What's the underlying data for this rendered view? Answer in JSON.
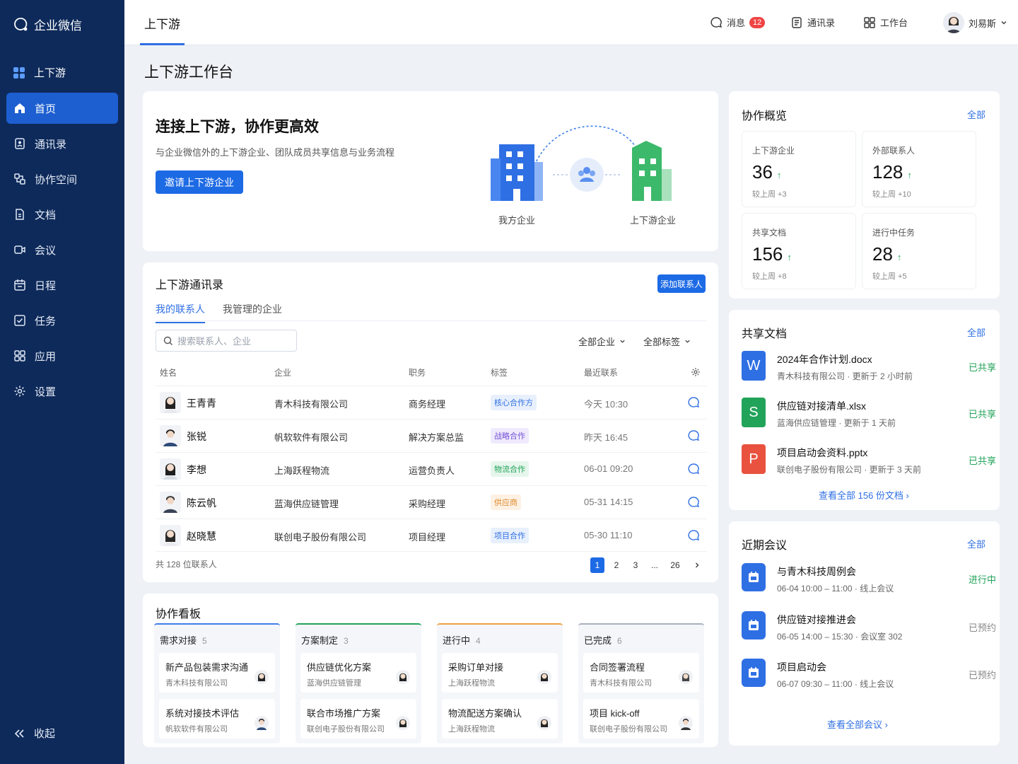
{
  "app": {
    "name": "企业微信"
  },
  "sidebar": {
    "group": "上下游",
    "items": [
      {
        "label": "首页"
      },
      {
        "label": "通讯录"
      },
      {
        "label": "协作空间"
      },
      {
        "label": "文档"
      },
      {
        "label": "会议"
      },
      {
        "label": "日程"
      },
      {
        "label": "任务"
      },
      {
        "label": "应用"
      },
      {
        "label": "设置"
      }
    ],
    "collapse": "收起"
  },
  "topbar": {
    "tab": "上下游",
    "messages": "消息",
    "message_count": "12",
    "contacts": "通讯录",
    "workbench": "工作台",
    "user": "刘易斯"
  },
  "page": {
    "title": "上下游工作台"
  },
  "hero": {
    "title": "连接上下游，协作更高效",
    "desc": "与企业微信外的上下游企业、团队成员共享信息与业务流程",
    "invite": "邀请上下游企业",
    "my_company": "我方企业",
    "partner_company": "上下游企业"
  },
  "contacts": {
    "title": "上下游通讯录",
    "add": "添加联系人",
    "tabs": [
      "我的联系人",
      "我管理的企业"
    ],
    "search_placeholder": "搜索联系人、企业",
    "filters": [
      "全部企业",
      "全部标签"
    ],
    "headers": [
      "姓名",
      "企业",
      "职务",
      "标签",
      "最近联系"
    ],
    "rows": [
      {
        "name": "王青青",
        "company": "青木科技有限公司",
        "title": "商务经理",
        "tag": "核心合作方",
        "time": "今天 10:30"
      },
      {
        "name": "张锐",
        "company": "帆软软件有限公司",
        "title": "解决方案总监",
        "tag": "战略合作",
        "time": "昨天 16:45"
      },
      {
        "name": "李想",
        "company": "上海跃程物流",
        "title": "运营负责人",
        "tag": "物流合作",
        "time": "06-01 09:20"
      },
      {
        "name": "陈云帆",
        "company": "蓝海供应链管理",
        "title": "采购经理",
        "tag": "供应商",
        "time": "05-31 14:15"
      },
      {
        "name": "赵晓慧",
        "company": "联创电子股份有限公司",
        "title": "项目经理",
        "tag": "项目合作",
        "time": "05-30 11:10"
      }
    ],
    "total": "共 128 位联系人",
    "pages": [
      "1",
      "2",
      "3",
      "...",
      "26"
    ]
  },
  "kanban": {
    "title": "协作看板",
    "columns": [
      {
        "name": "需求对接",
        "count": "5",
        "cards": [
          {
            "title": "新产品包装需求沟通",
            "company": "青木科技有限公司"
          },
          {
            "title": "系统对接技术评估",
            "company": "帆软软件有限公司"
          }
        ]
      },
      {
        "name": "方案制定",
        "count": "3",
        "cards": [
          {
            "title": "供应链优化方案",
            "company": "蓝海供应链管理"
          },
          {
            "title": "联合市场推广方案",
            "company": "联创电子股份有限公司"
          }
        ]
      },
      {
        "name": "进行中",
        "count": "4",
        "cards": [
          {
            "title": "采购订单对接",
            "company": "上海跃程物流"
          },
          {
            "title": "物流配送方案确认",
            "company": "上海跃程物流"
          }
        ]
      },
      {
        "name": "已完成",
        "count": "6",
        "cards": [
          {
            "title": "合同签署流程",
            "company": "青木科技有限公司"
          },
          {
            "title": "项目 kick-off",
            "company": "联创电子股份有限公司"
          }
        ]
      }
    ]
  },
  "overview": {
    "title": "协作概览",
    "all": "全部",
    "stats": [
      {
        "label": "上下游企业",
        "value": "36",
        "trend": "↑",
        "delta": "较上周 +3"
      },
      {
        "label": "外部联系人",
        "value": "128",
        "trend": "↑",
        "delta": "较上周 +10"
      },
      {
        "label": "共享文档",
        "value": "156",
        "trend": "↑",
        "delta": "较上周 +8"
      },
      {
        "label": "进行中任务",
        "value": "28",
        "trend": "↑",
        "delta": "较上周 +5"
      }
    ]
  },
  "docs": {
    "title": "共享文档",
    "all": "全部",
    "items": [
      {
        "icon": "W",
        "name": "2024年合作计划.docx",
        "meta": "青木科技有限公司 · 更新于 2 小时前",
        "status": "已共享"
      },
      {
        "icon": "S",
        "name": "供应链对接清单.xlsx",
        "meta": "蓝海供应链管理 · 更新于 1 天前",
        "status": "已共享"
      },
      {
        "icon": "P",
        "name": "项目启动会资料.pptx",
        "meta": "联创电子股份有限公司 · 更新于 3 天前",
        "status": "已共享"
      }
    ],
    "more": "查看全部 156 份文档 ›"
  },
  "meetings": {
    "title": "近期会议",
    "all": "全部",
    "items": [
      {
        "name": "与青木科技周例会",
        "meta": "06-04 10:00 – 11:00 · 线上会议",
        "status": "进行中"
      },
      {
        "name": "供应链对接推进会",
        "meta": "06-05 14:00 – 15:30 · 会议室 302",
        "status": "已预约"
      },
      {
        "name": "项目启动会",
        "meta": "06-07 09:30 – 11:00 · 线上会议",
        "status": "已预约"
      }
    ],
    "more": "查看全部会议 ›"
  },
  "colors": {
    "primary": "#1d6ae5",
    "sidebar": "#0e2a5a",
    "success": "#22a35a"
  }
}
